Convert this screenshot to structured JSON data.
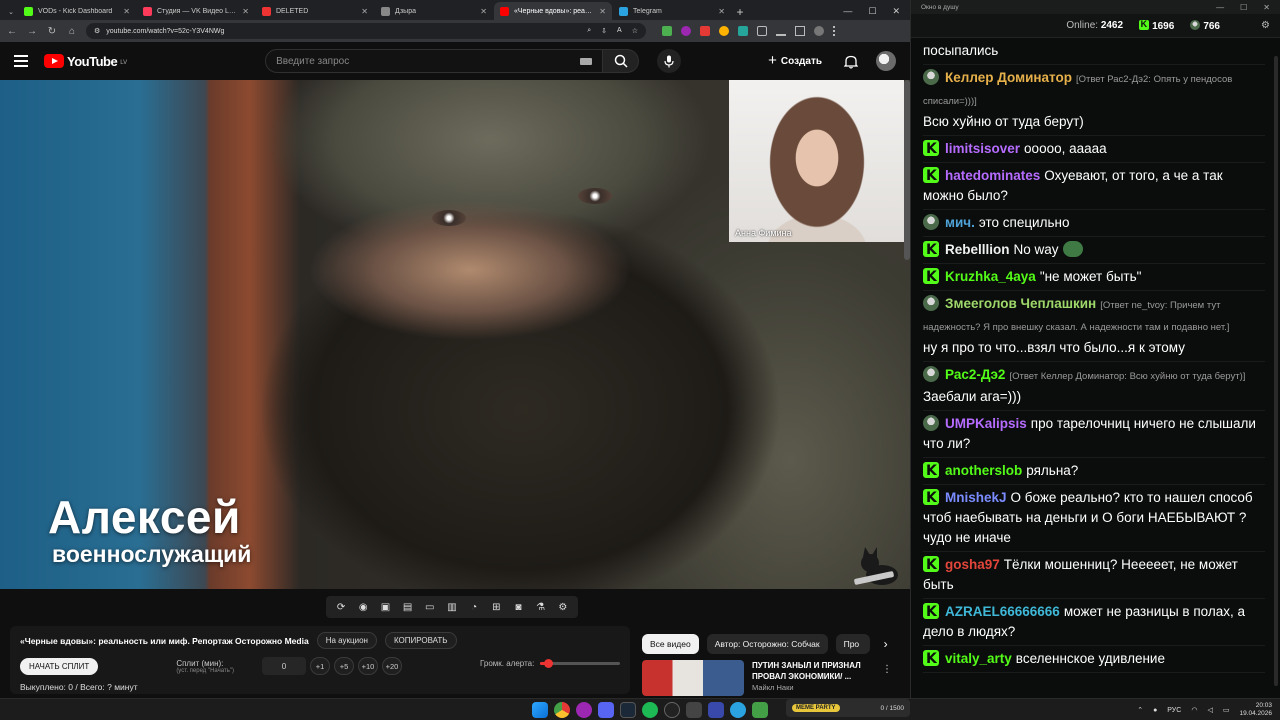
{
  "browser": {
    "tabs": [
      {
        "label": "VODs - Kick Dashboard",
        "color": "#53fc18",
        "active": false
      },
      {
        "label": "Студия — VK Видео Live",
        "color": "#ff3b5c",
        "active": false
      },
      {
        "label": "DELETED",
        "color": "#e33",
        "active": false
      },
      {
        "label": "Дзыра",
        "color": "#888",
        "active": false
      },
      {
        "label": "«Черные вдовы»: реальность",
        "color": "#ff0000",
        "active": true
      },
      {
        "label": "Telegram",
        "color": "#2aa3e0",
        "active": false
      }
    ],
    "url": "youtube.com/watch?v=52c-Y3V4NWg"
  },
  "youtube": {
    "logo_text": "YouTube",
    "logo_country": "LV",
    "search_placeholder": "Введите запрос",
    "create_label": "Создать"
  },
  "video": {
    "pip_label": "Анна Фимина",
    "overlay_name": "Алексей",
    "overlay_role": "военнослужащий"
  },
  "panel": {
    "title": "«Черные вдовы»: реальность или миф. Репортаж Осторожно Media",
    "auction_btn": "На аукцион",
    "copy_btn": "КОПИРОВАТЬ",
    "start_split_btn": "НАЧАТЬ СПЛИТ",
    "split_label": "Сплит (мин):",
    "split_hint": "(уст. перед \"Начать\")",
    "split_value": "0",
    "inc": [
      "+1",
      "+5",
      "+10",
      "+20"
    ],
    "alert_volume_label": "Громк. алерта:",
    "alert_volume": 0.1,
    "bought": "Выкуплено: 0 / Всего: ? минут"
  },
  "recs": {
    "chips": [
      "Все видео",
      "Автор: Осторожно: Собчак",
      "Про"
    ],
    "video_title_1": "ПУТИН ЗАНЫЛ И ПРИЗНАЛ",
    "video_title_2": "ПРОВАЛ ЭКОНОМИКИ/ ...",
    "video_channel": "Майкл Наки"
  },
  "chat": {
    "window_title": "Окно в душу",
    "online_label": "Online:",
    "online_value": "2462",
    "kick_count": "1696",
    "other_count": "766",
    "messages": [
      {
        "badge": "none",
        "user": "",
        "color": "#fff",
        "reply": "",
        "text": "посыпались"
      },
      {
        "badge": "avatar",
        "user": "Келлер Доминатор",
        "color": "#e6b04a",
        "reply": "[Ответ Рас2-Дэ2: Опять у пендосов списали=)))]",
        "text": "Всю хуйню от туда берут)"
      },
      {
        "badge": "kick",
        "user": "limitsisover",
        "color": "#b56cff",
        "reply": "",
        "text": "ооооо, ааааа"
      },
      {
        "badge": "kick",
        "user": "hatedominates",
        "color": "#b56cff",
        "reply": "",
        "text": "Охуевают, от того, а че а так можно было?"
      },
      {
        "badge": "avatar",
        "user": "мич.",
        "color": "#4fa3d8",
        "reply": "",
        "text": "это специльно"
      },
      {
        "badge": "kick",
        "user": "Rebelllion",
        "color": "#f0f0f0",
        "reply": "",
        "text": "No way",
        "emote": true
      },
      {
        "badge": "kick",
        "user": "Kruzhka_4aya",
        "color": "#53fc18",
        "reply": "",
        "text": "\"не может быть\""
      },
      {
        "badge": "avatar",
        "user": "Змееголов Чеплашкин",
        "color": "#9fd86a",
        "reply": "[Ответ ne_tvoy: Причем тут надежность? Я про внешку сказал. А надежности там и подавно нет.]",
        "text": "ну я про то что...взял что было...я к этому"
      },
      {
        "badge": "avatar",
        "user": "Рас2-Дэ2",
        "color": "#53fc18",
        "reply": "[Ответ Келлер Доминатор: Всю хуйню от туда берут)]",
        "text": "Заебали ага=)))"
      },
      {
        "badge": "avatar",
        "user": "UMPKalipsis",
        "color": "#b56cff",
        "reply": "",
        "text": "про тарелочниц ничего не слышали что ли?"
      },
      {
        "badge": "kick",
        "user": "anotherslob",
        "color": "#53fc18",
        "reply": "",
        "text": "ряльна?"
      },
      {
        "badge": "kick",
        "user": "MnishekJ",
        "color": "#7a8cff",
        "reply": "",
        "text": "О боже реально? кто то нашел способ чтоб наебывать на деньги и О боги НАЕБЫВАЮТ ? чудо не иначе"
      },
      {
        "badge": "kick",
        "user": "gosha97",
        "color": "#e2463b",
        "reply": "",
        "text": "Тёлки мошенниц? Неееeет, не может быть"
      },
      {
        "badge": "kick",
        "user": "AZRAEL66666666",
        "color": "#3fb8d8",
        "reply": "",
        "text": "может не разницы в полах, а дело в людях?"
      },
      {
        "badge": "kick",
        "user": "vitaly_arty",
        "color": "#53fc18",
        "reply": "",
        "text": "вселеннское удивление"
      }
    ]
  },
  "taskbar": {
    "meme_tag": "MEME PARTY",
    "meme_counter": "0 / 1500",
    "lang": "РУС",
    "time": "20:03",
    "date": "19.04.2026"
  }
}
